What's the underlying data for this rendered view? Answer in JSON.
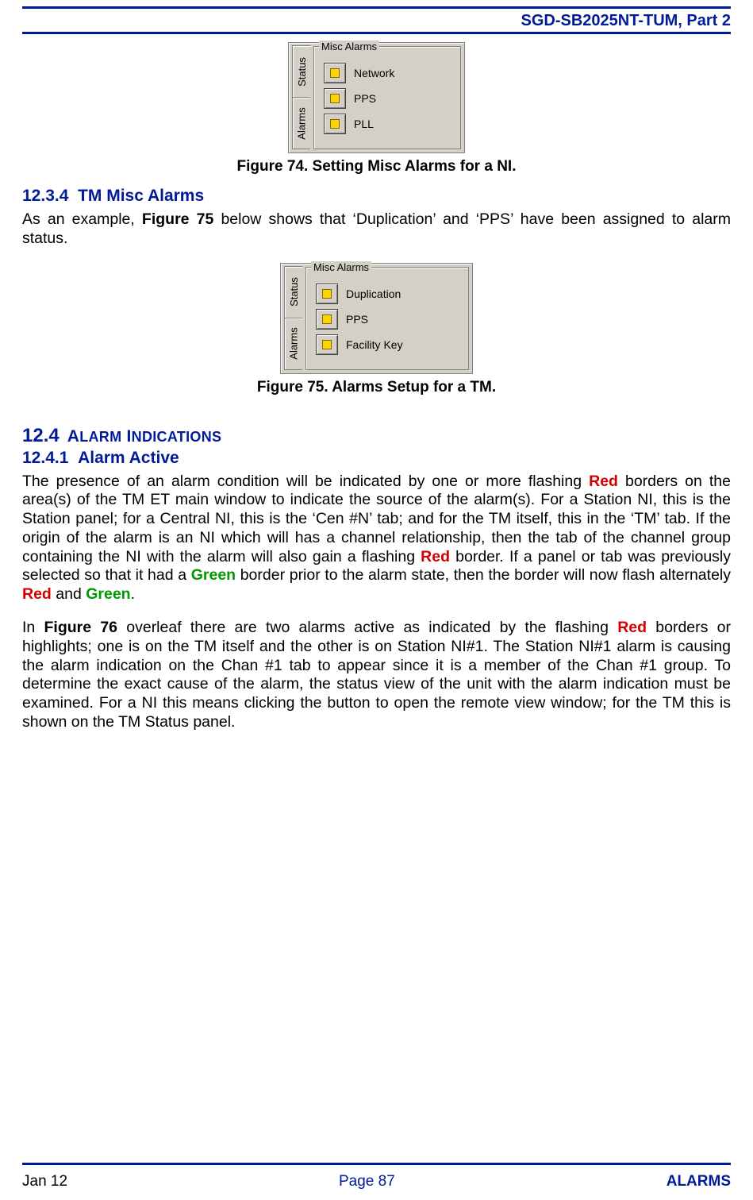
{
  "header": {
    "doc_title": "SGD-SB2025NT-TUM, Part 2"
  },
  "figure74": {
    "tabs": [
      "Status",
      "Alarms"
    ],
    "group_title": "Misc Alarms",
    "items": [
      "Network",
      "PPS",
      "PLL"
    ],
    "caption": "Figure 74.  Setting Misc Alarms for a NI."
  },
  "section_1234": {
    "number": "12.3.4",
    "title": "TM Misc Alarms",
    "para": "As an example, Figure 75 below shows that ‘Duplication’ and ‘PPS’ have been assigned to alarm status."
  },
  "figure75": {
    "tabs": [
      "Status",
      "Alarms"
    ],
    "group_title": "Misc Alarms",
    "items": [
      "Duplication",
      "PPS",
      "Facility Key"
    ],
    "caption": "Figure 75.  Alarms Setup for a TM."
  },
  "section_124": {
    "number": "12.4",
    "title": "ALARM INDICATIONS"
  },
  "section_1241": {
    "number": "12.4.1",
    "title": "Alarm Active"
  },
  "para1": {
    "t1": "The presence of an alarm condition will be indicated by one or more flashing ",
    "red1": "Red",
    "t2": " borders on the area(s) of the TM ET main window to indicate the source of the alarm(s).  For a Station NI, this is the Station panel; for a Central NI, this is the ‘Cen #N’ tab; and for the TM itself, this in the ‘TM’ tab.  If the origin of the alarm is an NI which will has a channel relationship, then the tab of the channel group containing the NI with the alarm will also gain a flashing ",
    "red2": "Red",
    "t3": " border.  If a panel or tab was previously selected so that it had a ",
    "green1": "Green",
    "t4": " border prior to the alarm state, then the border will now flash alternately ",
    "red3": "Red",
    "t5": " and ",
    "green2": "Green",
    "t6": "."
  },
  "para2": {
    "t1": "In ",
    "b1": "Figure 76",
    "t2": " overleaf there are two alarms active as indicated by the flashing ",
    "red1": "Red",
    "t3": " borders or highlights; one is on the TM itself and the other is on Station NI#1.   The Station NI#1 alarm is causing the alarm indication on the Chan #1 tab to appear since it is a member of the Chan #1 group.   To determine the exact cause of the alarm, the status view of the unit with the alarm indication must be examined.   For a NI this means clicking the button to open the remote view window; for the TM this is shown on the TM Status panel."
  },
  "footer": {
    "left": "Jan 12",
    "center": "Page 87",
    "right": "ALARMS"
  }
}
